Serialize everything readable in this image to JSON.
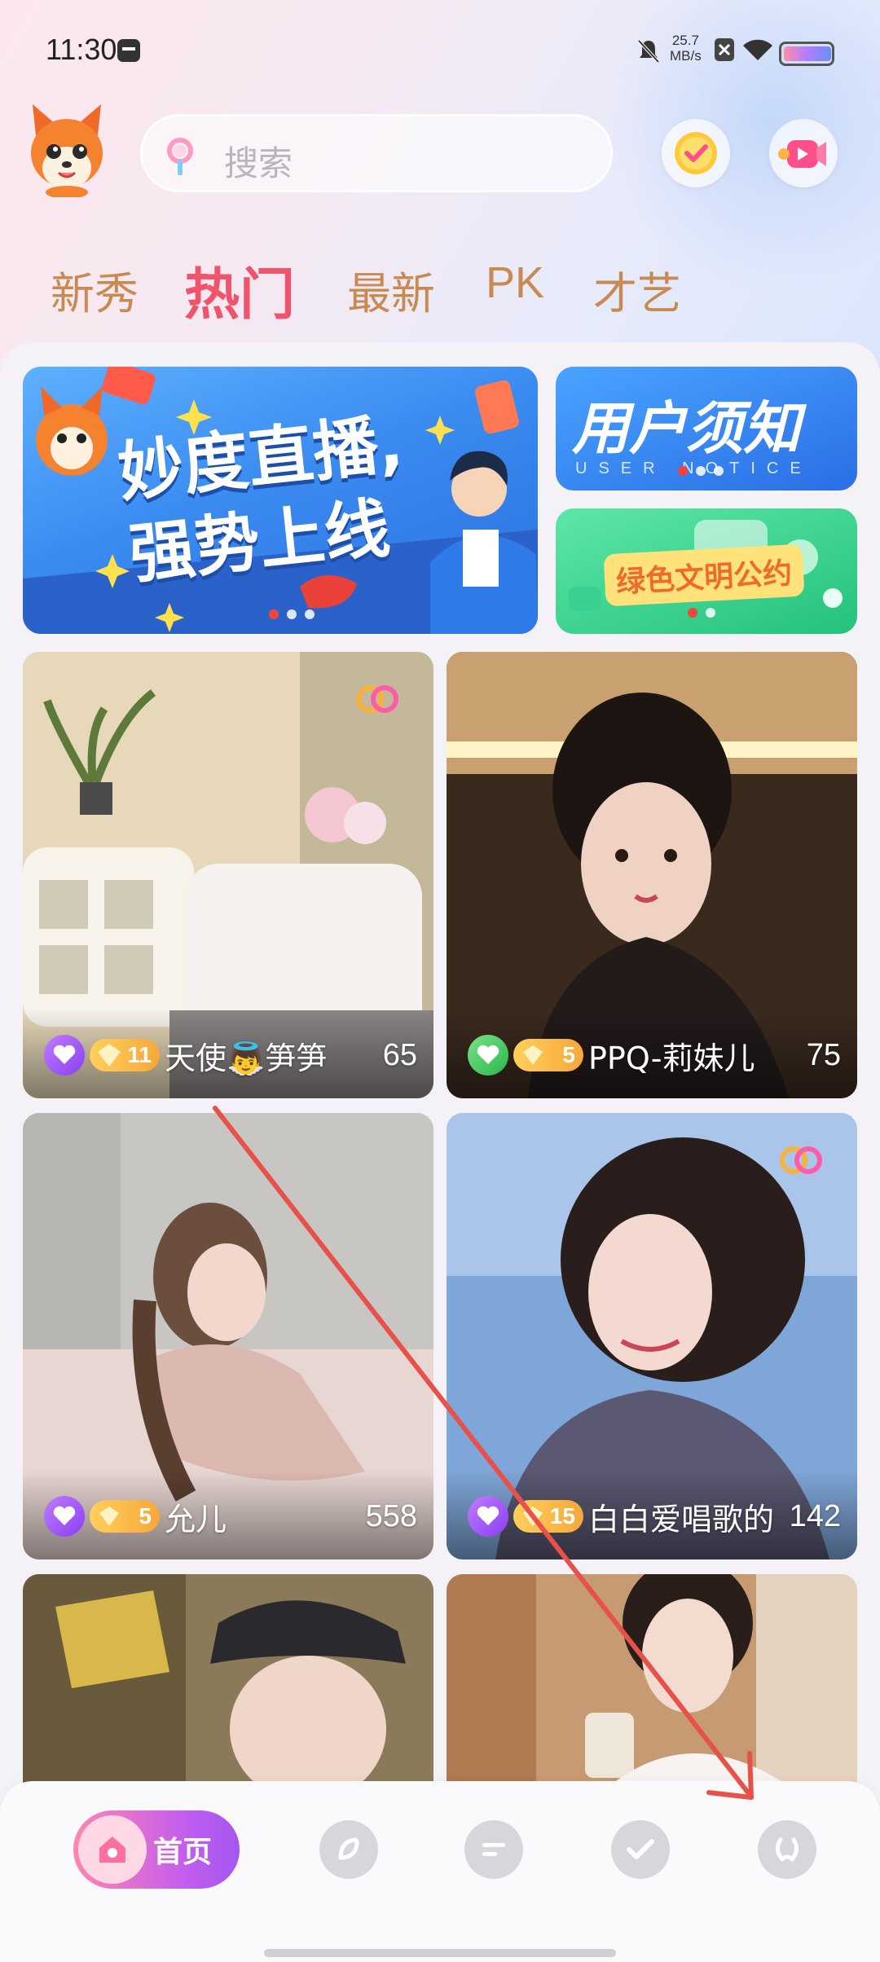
{
  "status_bar": {
    "time": "11:30",
    "net_speed_value": "25.7",
    "net_speed_unit": "MB/s",
    "icons": [
      "notification-icon",
      "mute-icon",
      "close-box-icon",
      "wifi-icon",
      "battery-icon"
    ]
  },
  "header": {
    "search_placeholder": "搜索",
    "icons": [
      "mascot-avatar",
      "coin-check-icon",
      "video-camera-icon"
    ]
  },
  "tabs": [
    {
      "label": "新秀",
      "active": false
    },
    {
      "label": "热门",
      "active": true
    },
    {
      "label": "最新",
      "active": false
    },
    {
      "label": "PK",
      "active": false
    },
    {
      "label": "才艺",
      "active": false
    }
  ],
  "banners": {
    "main": {
      "line1": "妙度直播,",
      "line2": "强势上线"
    },
    "notice": {
      "title": "用户须知",
      "subtitle": "USER NOTICE"
    },
    "convention": {
      "title": "绿色文明公约"
    }
  },
  "streams": [
    {
      "name": "天使👼笋笋",
      "count": "65",
      "heart": "purple",
      "level": "11"
    },
    {
      "name": "PPQ-莉妹儿",
      "count": "75",
      "heart": "green",
      "level": "5"
    },
    {
      "name": "允儿",
      "count": "558",
      "heart": "purple",
      "level": "5"
    },
    {
      "name": "白白爱唱歌的",
      "count": "142",
      "heart": "purple",
      "level": "15"
    },
    {
      "name": "",
      "count": "",
      "heart": "",
      "level": ""
    },
    {
      "name": "",
      "count": "",
      "heart": "",
      "level": ""
    }
  ],
  "bottom_nav": {
    "home_label": "首页",
    "items": [
      "home-icon",
      "discover-icon",
      "message-icon",
      "follow-heart-icon",
      "profile-icon"
    ]
  },
  "colors": {
    "accent": "#f0546a",
    "tab_inactive": "#c98a52",
    "home_pill_start": "#ff86b1",
    "home_pill_end": "#a257f0"
  }
}
